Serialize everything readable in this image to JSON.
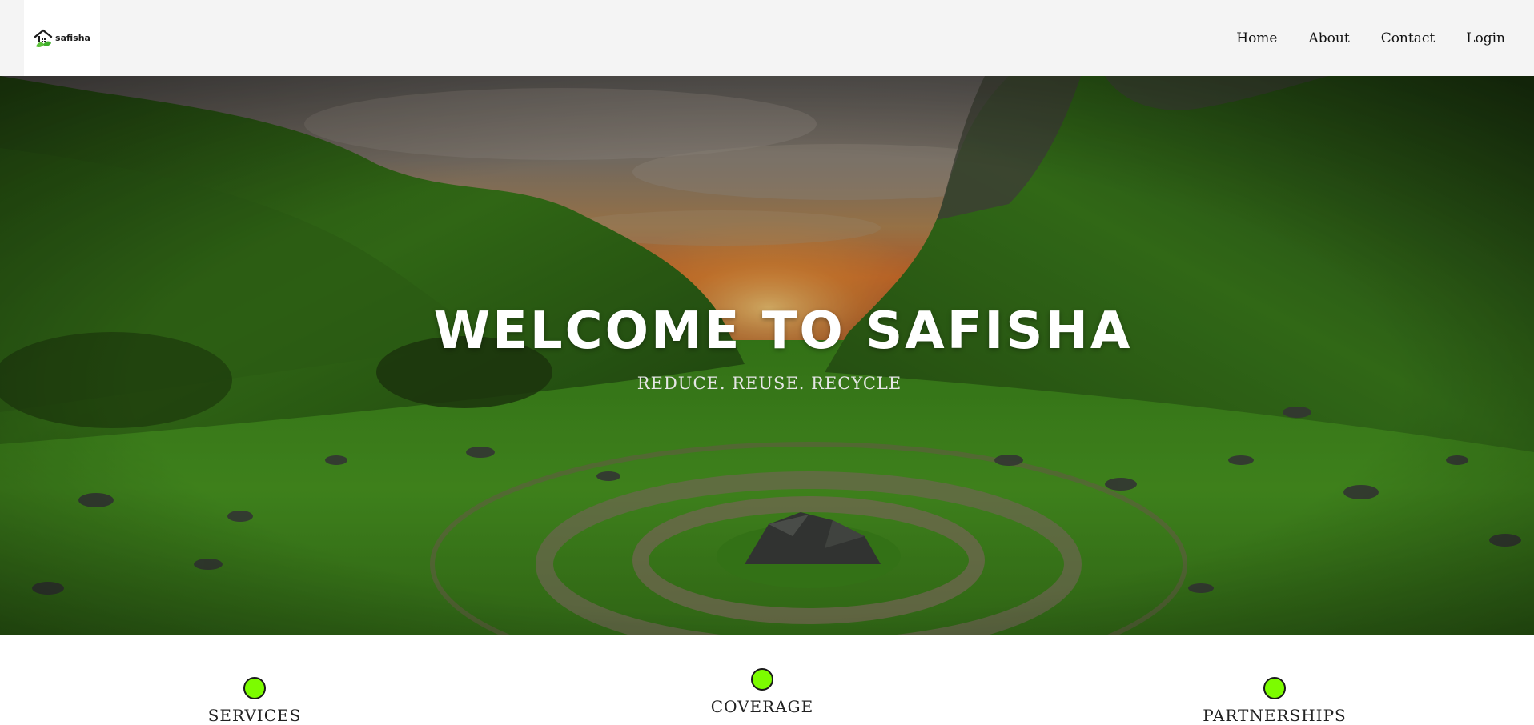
{
  "brand": {
    "name": "safisha"
  },
  "nav": {
    "items": [
      {
        "label": "Home"
      },
      {
        "label": "About"
      },
      {
        "label": "Contact"
      },
      {
        "label": "Login"
      }
    ]
  },
  "hero": {
    "title": "WELCOME TO SAFISHA",
    "subtitle": "REDUCE. REUSE. RECYCLE",
    "image": "green valley with stone spiral at sunset"
  },
  "features": [
    {
      "label": "SERVICES",
      "icon": "green-dot-icon"
    },
    {
      "label": "COVERAGE",
      "icon": "green-dot-icon"
    },
    {
      "label": "PARTNERSHIPS",
      "icon": "green-dot-icon"
    }
  ],
  "colors": {
    "navbar_bg": "#f4f4f4",
    "accent_green": "#7cfc00",
    "hero_text": "#ffffff"
  }
}
